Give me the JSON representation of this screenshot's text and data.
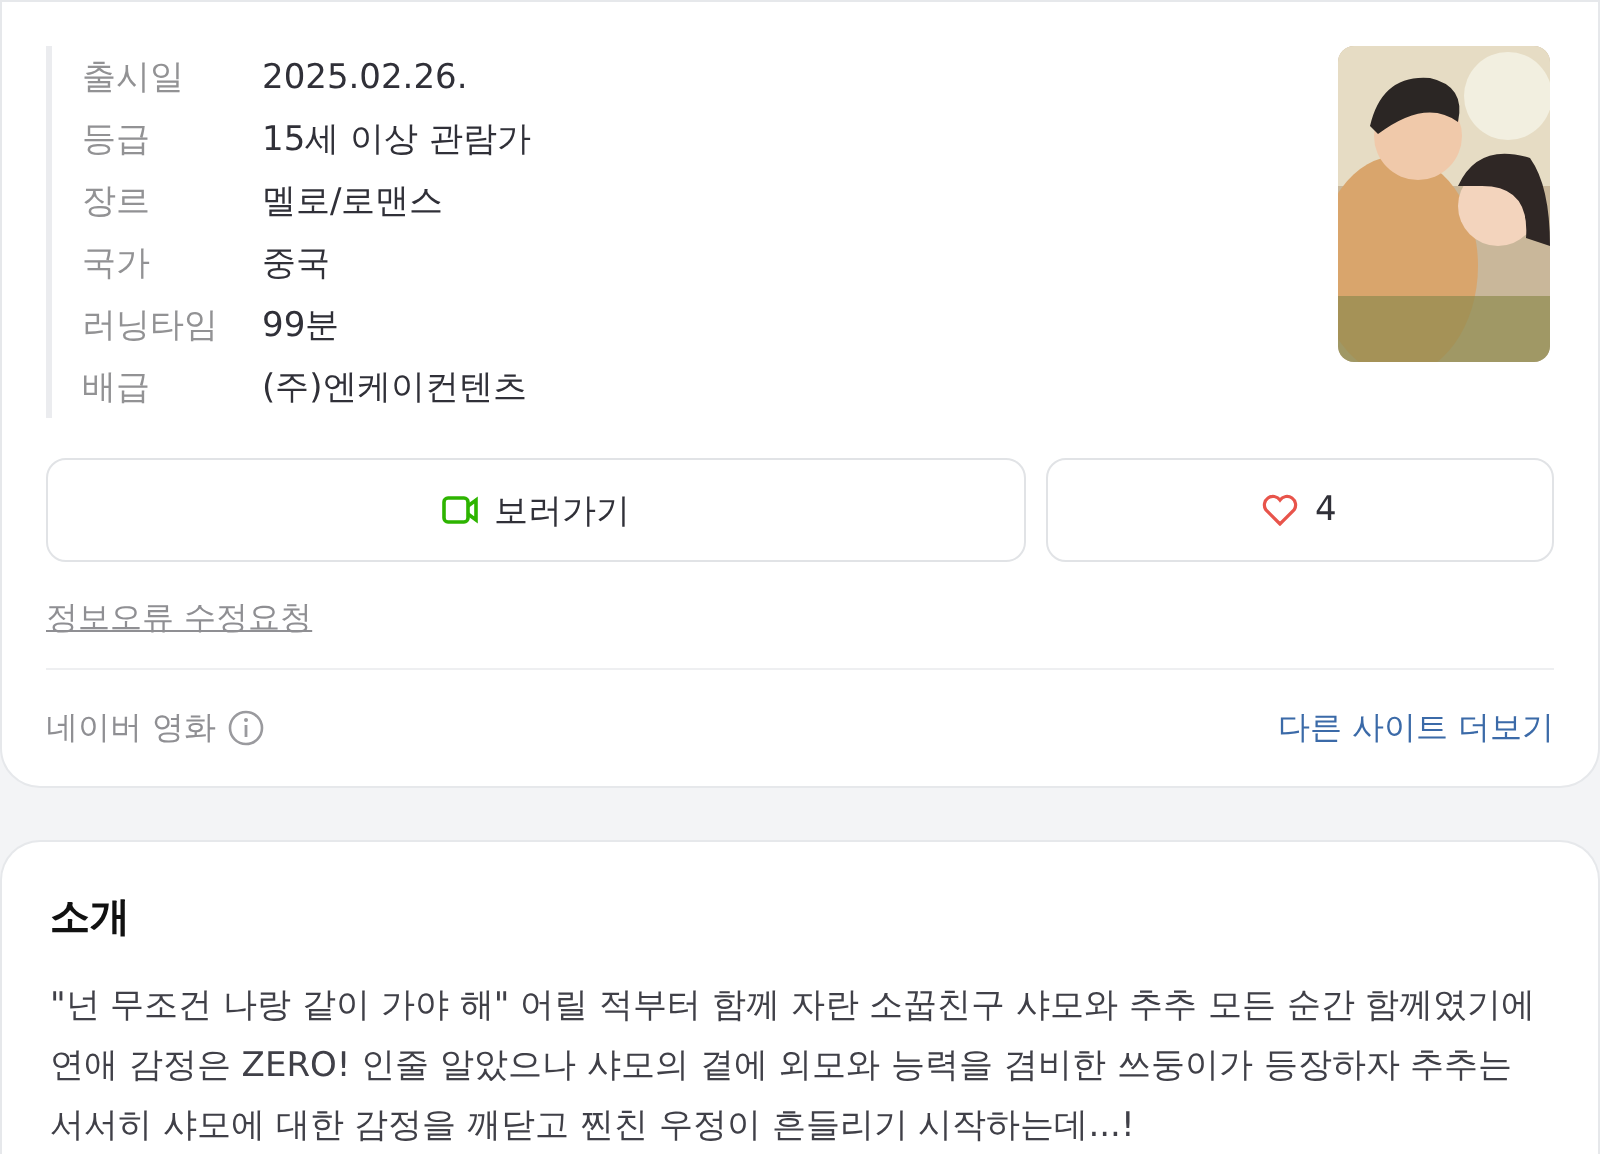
{
  "info": [
    {
      "label": "출시일",
      "value": "2025.02.26."
    },
    {
      "label": "등급",
      "value": "15세 이상 관람가"
    },
    {
      "label": "장르",
      "value": "멜로/로맨스"
    },
    {
      "label": "국가",
      "value": "중국"
    },
    {
      "label": "러닝타임",
      "value": "99분"
    },
    {
      "label": "배급",
      "value": "(주)엔케이컨텐츠"
    }
  ],
  "watch_button": {
    "label": "보러가기"
  },
  "like_button": {
    "count": "4",
    "liked": false
  },
  "error_report_link": "정보오류 수정요청",
  "source": {
    "label": "네이버 영화",
    "more_link": "다른 사이트 더보기"
  },
  "intro": {
    "title": "소개",
    "text": "\"넌 무조건 나랑 같이 가야 해\" 어릴 적부터 함께 자란 소꿉친구 샤모와 추추 모든 순간 함께였기에 연애 감정은 ZERO! 인줄 알았으나 샤모의 곁에 외모와 능력을 겸비한 쓰둥이가 등장하자 추추는 서서히 샤모에 대한 감정을 깨닫고 찐친 우정이 흔들리기 시작하는데...!"
  }
}
